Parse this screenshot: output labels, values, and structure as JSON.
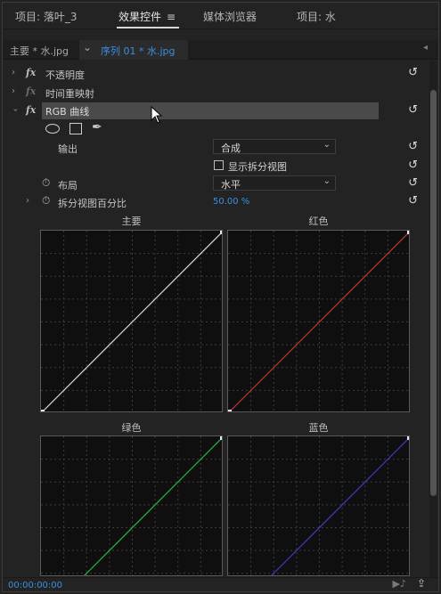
{
  "tabs": {
    "project_leaves": "项目: 落叶_3",
    "effect_controls": "效果控件",
    "media_browser": "媒体浏览器",
    "project_water": "项目: 水"
  },
  "source": {
    "master": "主要 * 水.jpg",
    "sequence": "序列 01 * 水.jpg"
  },
  "effects": {
    "opacity": "不透明度",
    "time_remap": "时间重映射",
    "rgb_curves": "RGB 曲线"
  },
  "properties": {
    "output_label": "输出",
    "output_value": "合成",
    "show_split_label": "显示拆分视图",
    "layout_label": "布局",
    "layout_value": "水平",
    "split_pct_label": "拆分视图百分比",
    "split_pct_value": "50.00 %"
  },
  "curves": {
    "master": "主要",
    "red": "红色",
    "green": "绿色",
    "blue": "蓝色"
  },
  "colors": {
    "accent": "#3a8fe0",
    "master_line": "#d8d8d8",
    "red_line": "#c0342f",
    "green_line": "#29b24a",
    "blue_line": "#3a3ad6"
  },
  "timecode": "00:00:00:00"
}
